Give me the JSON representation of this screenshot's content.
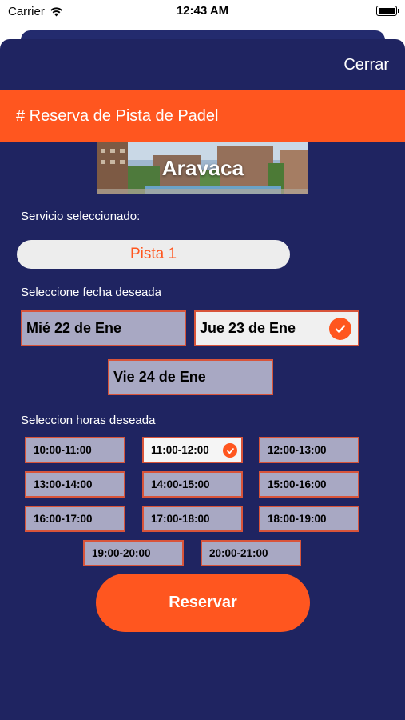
{
  "status_bar": {
    "carrier": "Carrier",
    "time": "12:43 AM"
  },
  "header": {
    "close_label": "Cerrar",
    "title": "# Reserva de Pista de Padel"
  },
  "banner": {
    "text": "Aravaca"
  },
  "service": {
    "label": "Servicio seleccionado:",
    "value": "Pista 1"
  },
  "dates": {
    "label": "Seleccione fecha deseada",
    "items": [
      {
        "label": "Mié 22 de Ene",
        "selected": false
      },
      {
        "label": "Jue 23 de Ene",
        "selected": true
      },
      {
        "label": "Vie 24 de Ene",
        "selected": false
      }
    ]
  },
  "hours": {
    "label": "Seleccion horas deseada",
    "items": [
      {
        "label": "10:00-11:00",
        "selected": false
      },
      {
        "label": "11:00-12:00",
        "selected": true
      },
      {
        "label": "12:00-13:00",
        "selected": false
      },
      {
        "label": "13:00-14:00",
        "selected": false
      },
      {
        "label": "14:00-15:00",
        "selected": false
      },
      {
        "label": "15:00-16:00",
        "selected": false
      },
      {
        "label": "16:00-17:00",
        "selected": false
      },
      {
        "label": "17:00-18:00",
        "selected": false
      },
      {
        "label": "18:00-19:00",
        "selected": false
      },
      {
        "label": "19:00-20:00",
        "selected": false
      },
      {
        "label": "20:00-21:00",
        "selected": false
      }
    ]
  },
  "actions": {
    "reserve_label": "Reservar"
  },
  "colors": {
    "accent": "#ff561f",
    "background": "#1f2461",
    "unselected": "#a8a8c3",
    "border": "#d8543a"
  }
}
